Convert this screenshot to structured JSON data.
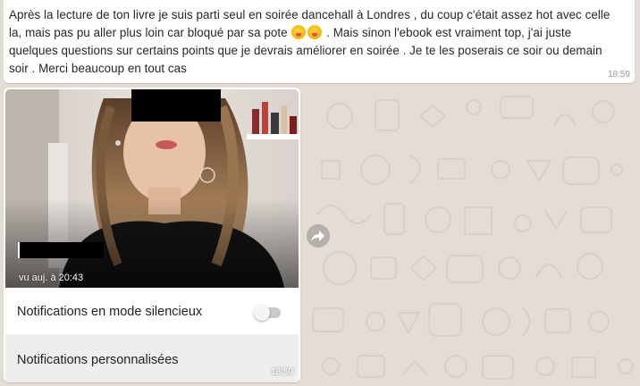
{
  "message_1": {
    "text_before_emoji": "Après la lecture de ton livre je suis parti seul en soirée dancehall à Londres , du coup c'était assez hot avec celle la, mais pas pu aller plus loin car bloqué par sa pote",
    "emojis": [
      "squinting-face-with-tongue-emoji",
      "squinting-face-with-tongue-emoji"
    ],
    "text_after_emoji": " . Mais sinon l'ebook est vraiment top, j'ai juste quelques questions sur certains points que je devrais améliorer en soirée . Je te les poserais ce soir ou demain soir . Merci beaucoup en tout cas",
    "time": "18:59"
  },
  "message_2": {
    "photo_status": "vu auj. à 20:43",
    "row_silent_label": "Notifications en mode silencieux",
    "row_silent_toggle": "off",
    "row_custom_label": "Notifications personnalisées",
    "time": "18:59"
  },
  "icons": {
    "forward": "forward-icon"
  },
  "colors": {
    "chat_background": "#e4ddd5",
    "bubble": "#ffffff",
    "timestamp": "#999999"
  }
}
